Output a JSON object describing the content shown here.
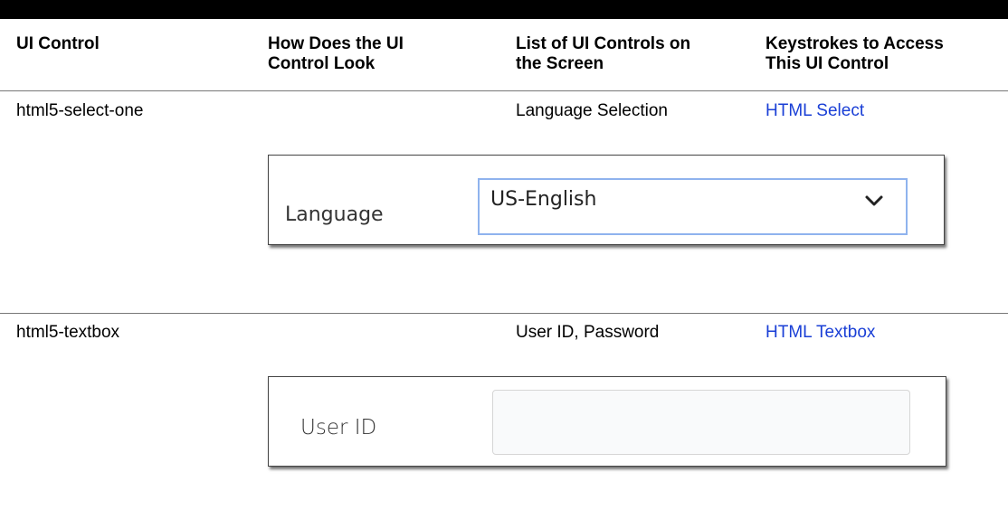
{
  "table": {
    "headers": [
      "UI Control",
      "How Does the UI Control Look",
      "List of UI Controls on the Screen",
      "Keystrokes to Access This UI Control"
    ],
    "header_lines": {
      "col1": [
        "UI Control"
      ],
      "col2": [
        "How Does the UI",
        "Control Look"
      ],
      "col3": [
        "List of UI Controls on",
        "the Screen"
      ],
      "col4": [
        "Keystrokes to Access",
        "This UI Control"
      ]
    },
    "rows": [
      {
        "control": "html5-select-one",
        "controls_on_screen": "Language Selection",
        "keystrokes_link": "HTML Select",
        "illustration": {
          "label": "Language",
          "selected_value": "US-English",
          "icon": "chevron-down-icon"
        }
      },
      {
        "control": "html5-textbox",
        "controls_on_screen": "User ID, Password",
        "keystrokes_link": "HTML Textbox",
        "illustration": {
          "label": "User ID",
          "value": ""
        }
      }
    ]
  },
  "colors": {
    "link": "#1a3fd6",
    "select_focus_border": "#8fb3ee",
    "rule": "#777777"
  }
}
